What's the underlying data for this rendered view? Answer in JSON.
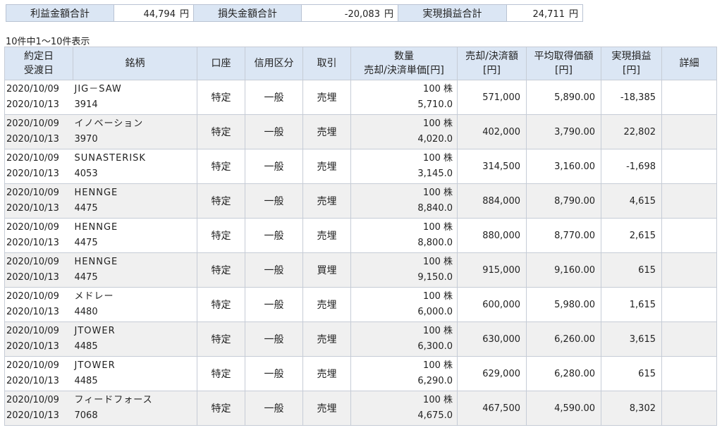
{
  "summary": [
    {
      "label": "利益金額合計",
      "value": "44,794",
      "unit": "円"
    },
    {
      "label": "損失金額合計",
      "value": "-20,083",
      "unit": "円"
    },
    {
      "label": "実現損益合計",
      "value": "24,711",
      "unit": "円"
    }
  ],
  "count_text": "10件中1〜10件表示",
  "headers": {
    "date1": "約定日",
    "date2": "受渡日",
    "name": "銘柄",
    "account": "口座",
    "credit": "信用区分",
    "trade": "取引",
    "qty1": "数量",
    "qty2": "売却/決済単価[円]",
    "amount1": "売却/決済額",
    "amount2": "[円]",
    "avg1": "平均取得価額",
    "avg2": "[円]",
    "pl1": "実現損益",
    "pl2": "[円]",
    "detail": "詳細"
  },
  "rows": [
    {
      "trade_date": "2020/10/09",
      "settle_date": "2020/10/13",
      "name": "JIG－SAW",
      "code": "3914",
      "account": "特定",
      "credit": "一般",
      "trade": "売埋",
      "qty": "100 株",
      "price": "5,710.0",
      "amount": "571,000",
      "avg": "5,890.00",
      "pl": "-18,385",
      "detail": ""
    },
    {
      "trade_date": "2020/10/09",
      "settle_date": "2020/10/13",
      "name": "イノベーション",
      "code": "3970",
      "account": "特定",
      "credit": "一般",
      "trade": "売埋",
      "qty": "100 株",
      "price": "4,020.0",
      "amount": "402,000",
      "avg": "3,790.00",
      "pl": "22,802",
      "detail": ""
    },
    {
      "trade_date": "2020/10/09",
      "settle_date": "2020/10/13",
      "name": "SUNASTERISK",
      "code": "4053",
      "account": "特定",
      "credit": "一般",
      "trade": "売埋",
      "qty": "100 株",
      "price": "3,145.0",
      "amount": "314,500",
      "avg": "3,160.00",
      "pl": "-1,698",
      "detail": ""
    },
    {
      "trade_date": "2020/10/09",
      "settle_date": "2020/10/13",
      "name": "HENNGE",
      "code": "4475",
      "account": "特定",
      "credit": "一般",
      "trade": "売埋",
      "qty": "100 株",
      "price": "8,840.0",
      "amount": "884,000",
      "avg": "8,790.00",
      "pl": "4,615",
      "detail": ""
    },
    {
      "trade_date": "2020/10/09",
      "settle_date": "2020/10/13",
      "name": "HENNGE",
      "code": "4475",
      "account": "特定",
      "credit": "一般",
      "trade": "売埋",
      "qty": "100 株",
      "price": "8,800.0",
      "amount": "880,000",
      "avg": "8,770.00",
      "pl": "2,615",
      "detail": ""
    },
    {
      "trade_date": "2020/10/09",
      "settle_date": "2020/10/13",
      "name": "HENNGE",
      "code": "4475",
      "account": "特定",
      "credit": "一般",
      "trade": "買埋",
      "qty": "100 株",
      "price": "9,150.0",
      "amount": "915,000",
      "avg": "9,160.00",
      "pl": "615",
      "detail": ""
    },
    {
      "trade_date": "2020/10/09",
      "settle_date": "2020/10/13",
      "name": "メドレー",
      "code": "4480",
      "account": "特定",
      "credit": "一般",
      "trade": "売埋",
      "qty": "100 株",
      "price": "6,000.0",
      "amount": "600,000",
      "avg": "5,980.00",
      "pl": "1,615",
      "detail": ""
    },
    {
      "trade_date": "2020/10/09",
      "settle_date": "2020/10/13",
      "name": "JTOWER",
      "code": "4485",
      "account": "特定",
      "credit": "一般",
      "trade": "売埋",
      "qty": "100 株",
      "price": "6,300.0",
      "amount": "630,000",
      "avg": "6,260.00",
      "pl": "3,615",
      "detail": ""
    },
    {
      "trade_date": "2020/10/09",
      "settle_date": "2020/10/13",
      "name": "JTOWER",
      "code": "4485",
      "account": "特定",
      "credit": "一般",
      "trade": "売埋",
      "qty": "100 株",
      "price": "6,290.0",
      "amount": "629,000",
      "avg": "6,280.00",
      "pl": "615",
      "detail": ""
    },
    {
      "trade_date": "2020/10/09",
      "settle_date": "2020/10/13",
      "name": "フィードフォース",
      "code": "7068",
      "account": "特定",
      "credit": "一般",
      "trade": "売埋",
      "qty": "100 株",
      "price": "4,675.0",
      "amount": "467,500",
      "avg": "4,590.00",
      "pl": "8,302",
      "detail": ""
    }
  ]
}
